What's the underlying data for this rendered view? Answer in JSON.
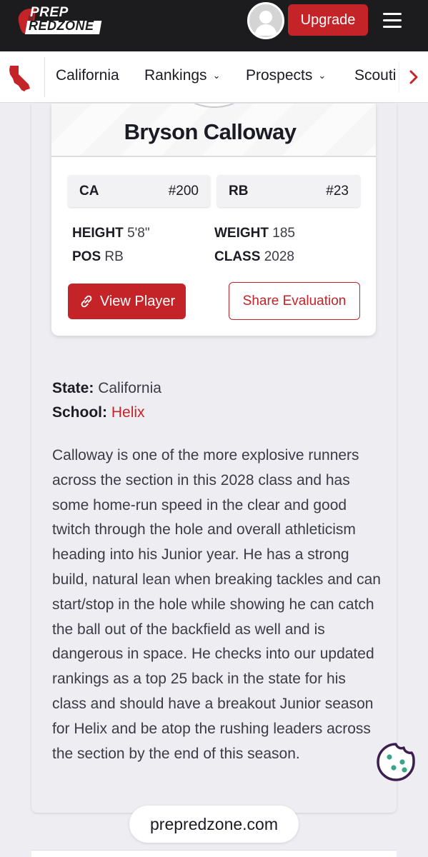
{
  "header": {
    "logo_line1": "PREP",
    "logo_line2": "REDZONE",
    "upgrade_label": "Upgrade"
  },
  "subnav": {
    "items": [
      {
        "label": "California"
      },
      {
        "label": "Rankings"
      },
      {
        "label": "Prospects"
      },
      {
        "label": "Scouting"
      }
    ]
  },
  "player": {
    "name": "Bryson Calloway",
    "rank_state": {
      "label": "CA",
      "value": "#200"
    },
    "rank_position": {
      "label": "RB",
      "value": "#23"
    },
    "height_label": "HEIGHT",
    "height_value": "5'8\"",
    "weight_label": "WEIGHT",
    "weight_value": "185",
    "pos_label": "POS",
    "pos_value": "RB",
    "class_label": "CLASS",
    "class_value": "2028",
    "view_player_label": "View Player",
    "share_label": "Share Evaluation"
  },
  "details": {
    "state_label": "State:",
    "state_value": "California",
    "school_label": "School:",
    "school_value": "Helix"
  },
  "evaluation": "Calloway is one of the more explosive runners across the section in this 2028 class and has some home-run speed in the clear and good twitch through the hole and overall athleticism heading into his Junior year. He has a strong build, natural lean when breaking tackles and can start/stop in the hole while showing he can catch the ball out of the backfield as well and is dangerous in space. He checks into our updated rankings as a top 25 back in the state for his class and should have a breakout Junior season for Helix and be atop the rushing leaders across the section by the end of this season.",
  "footer": {
    "site": "prepredzone.com"
  },
  "colors": {
    "brand_red": "#c42327",
    "header_bg": "#1c1c1f"
  }
}
